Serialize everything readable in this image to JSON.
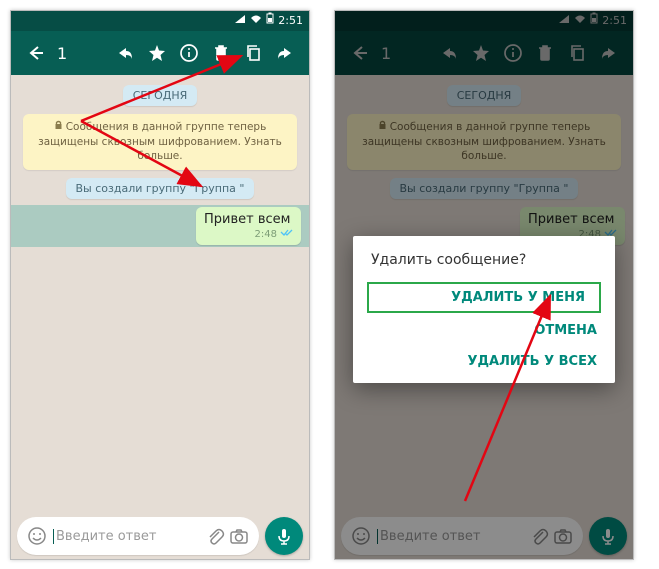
{
  "status": {
    "time": "2:51"
  },
  "nav": {
    "selected_count": "1"
  },
  "chat": {
    "date_chip": "СЕГОДНЯ",
    "encryption_notice": "Сообщения в данной группе теперь защищены сквозным шифрованием. Узнать больше.",
    "system_msg": "Вы создали группу \"Группа \"",
    "bubble_text": "Привет всем",
    "bubble_time": "2:48"
  },
  "composer": {
    "placeholder": "Введите ответ"
  },
  "dialog": {
    "title": "Удалить сообщение?",
    "delete_me": "УДАЛИТЬ У МЕНЯ",
    "cancel": "ОТМЕНА",
    "delete_all": "УДАЛИТЬ У ВСЕХ"
  }
}
